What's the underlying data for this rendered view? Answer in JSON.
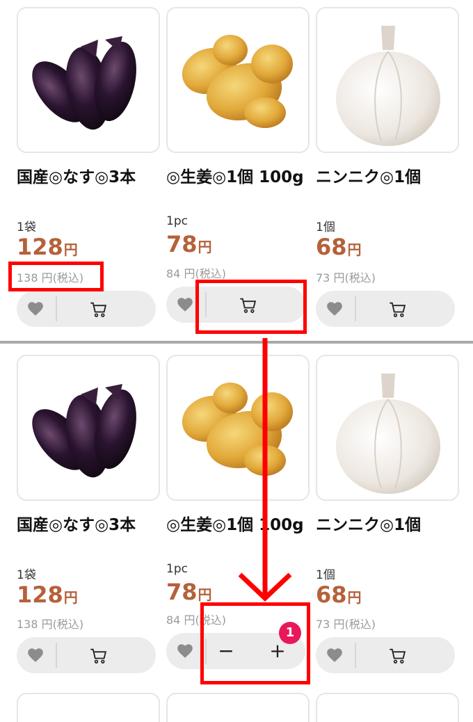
{
  "products": [
    {
      "name": "国産◎なす◎3本",
      "unit": "1袋",
      "price": "128",
      "currency": "円",
      "tax_price": "138 円(税込)"
    },
    {
      "name": "◎生姜◎1個 100g",
      "unit": "1pc",
      "price": "78",
      "currency": "円",
      "tax_price": "84 円(税込)"
    },
    {
      "name": "ニンニク◎1個",
      "unit": "1個",
      "price": "68",
      "currency": "円",
      "tax_price": "73 円(税込)"
    }
  ],
  "icons": {
    "favorite": "heart-icon",
    "cart": "cart-icon"
  },
  "stepper": {
    "minus": "−",
    "plus": "+",
    "quantity_badge": "1"
  },
  "colors": {
    "price": "#b5613a",
    "badge": "#e8185a",
    "annotation": "#ff0000"
  }
}
